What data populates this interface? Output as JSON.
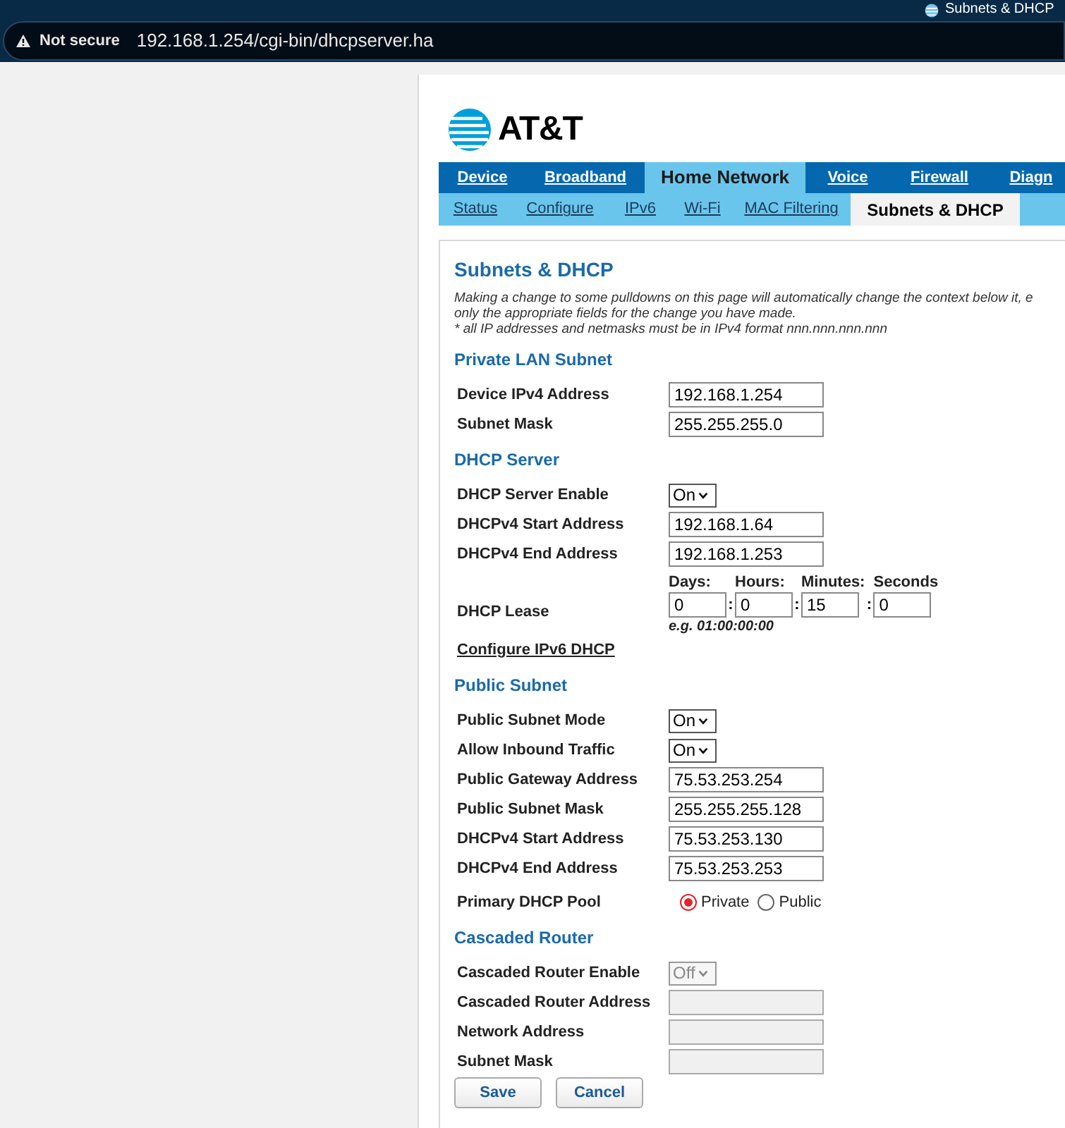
{
  "browser": {
    "tab_title": "Subnets & DHCP",
    "security_label": "Not secure",
    "url": "192.168.1.254/cgi-bin/dhcpserver.ha"
  },
  "logo": {
    "text": "AT&T"
  },
  "main_tabs": [
    {
      "label": "Device",
      "selected": false
    },
    {
      "label": "Broadband",
      "selected": false
    },
    {
      "label": "Home Network",
      "selected": true
    },
    {
      "label": "Voice",
      "selected": false
    },
    {
      "label": "Firewall",
      "selected": false
    },
    {
      "label": "Diagn",
      "selected": false
    }
  ],
  "sub_tabs": [
    {
      "label": "Status",
      "selected": false
    },
    {
      "label": "Configure",
      "selected": false
    },
    {
      "label": "IPv6",
      "selected": false
    },
    {
      "label": "Wi-Fi",
      "selected": false
    },
    {
      "label": "MAC Filtering",
      "selected": false
    },
    {
      "label": "Subnets & DHCP",
      "selected": true
    }
  ],
  "content": {
    "title": "Subnets & DHCP",
    "notes": [
      "Making a change to some pulldowns on this page will automatically change the context below it, e",
      "only the appropriate fields for the change you have made.",
      "* all IP addresses and netmasks must be in IPv4 format nnn.nnn.nnn.nnn"
    ],
    "sections": [
      {
        "heading": "Private LAN Subnet",
        "rows": [
          {
            "kind": "text",
            "label": "Device IPv4 Address",
            "value": "192.168.1.254",
            "disabled": false
          },
          {
            "kind": "text",
            "label": "Subnet Mask",
            "value": "255.255.255.0",
            "disabled": false
          }
        ]
      },
      {
        "heading": "DHCP Server",
        "rows": [
          {
            "kind": "select",
            "label": "DHCP Server Enable",
            "value": "On",
            "disabled": false
          },
          {
            "kind": "text",
            "label": "DHCPv4 Start Address",
            "value": "192.168.1.64",
            "disabled": false
          },
          {
            "kind": "text",
            "label": "DHCPv4 End Address",
            "value": "192.168.1.253",
            "disabled": false
          },
          {
            "kind": "lease",
            "label": "DHCP Lease",
            "parts": [
              {
                "label": "Days:",
                "value": "0"
              },
              {
                "label": "Hours:",
                "value": "0"
              },
              {
                "label": "Minutes:",
                "value": "15"
              },
              {
                "label": "Seconds",
                "value": "0"
              }
            ],
            "separator": ":",
            "hint": "e.g. 01:00:00:00"
          },
          {
            "kind": "link",
            "label": "Configure IPv6 DHCP"
          }
        ]
      },
      {
        "heading": "Public Subnet",
        "rows": [
          {
            "kind": "select",
            "label": "Public Subnet Mode",
            "value": "On",
            "disabled": false
          },
          {
            "kind": "select",
            "label": "Allow Inbound Traffic",
            "value": "On",
            "disabled": false
          },
          {
            "kind": "text",
            "label": "Public Gateway Address",
            "value": "75.53.253.254",
            "disabled": false
          },
          {
            "kind": "text",
            "label": "Public Subnet Mask",
            "value": "255.255.255.128",
            "disabled": false
          },
          {
            "kind": "text",
            "label": "DHCPv4 Start Address",
            "value": "75.53.253.130",
            "disabled": false
          },
          {
            "kind": "text",
            "label": "DHCPv4 End Address",
            "value": "75.53.253.253",
            "disabled": false
          },
          {
            "kind": "radio",
            "label": "Primary DHCP Pool",
            "options": [
              {
                "label": "Private",
                "selected": true
              },
              {
                "label": "Public",
                "selected": false
              }
            ]
          }
        ]
      },
      {
        "heading": "Cascaded Router",
        "rows": [
          {
            "kind": "select",
            "label": "Cascaded Router Enable",
            "value": "Off",
            "disabled": true
          },
          {
            "kind": "text",
            "label": "Cascaded Router Address",
            "disabled": true
          },
          {
            "kind": "text",
            "label": "Network Address",
            "disabled": true
          },
          {
            "kind": "text",
            "label": "Subnet Mask",
            "disabled": true
          }
        ]
      }
    ],
    "buttons": [
      "Save",
      "Cancel"
    ]
  }
}
